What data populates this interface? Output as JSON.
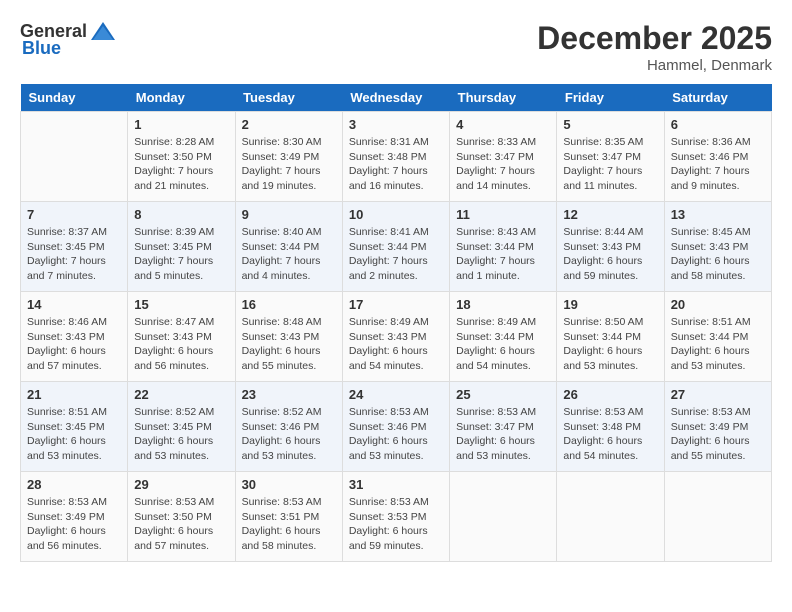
{
  "header": {
    "logo_general": "General",
    "logo_blue": "Blue",
    "month_title": "December 2025",
    "location": "Hammel, Denmark"
  },
  "calendar": {
    "days_of_week": [
      "Sunday",
      "Monday",
      "Tuesday",
      "Wednesday",
      "Thursday",
      "Friday",
      "Saturday"
    ],
    "weeks": [
      [
        {
          "day": "",
          "sunrise": "",
          "sunset": "",
          "daylight": ""
        },
        {
          "day": "1",
          "sunrise": "Sunrise: 8:28 AM",
          "sunset": "Sunset: 3:50 PM",
          "daylight": "Daylight: 7 hours and 21 minutes."
        },
        {
          "day": "2",
          "sunrise": "Sunrise: 8:30 AM",
          "sunset": "Sunset: 3:49 PM",
          "daylight": "Daylight: 7 hours and 19 minutes."
        },
        {
          "day": "3",
          "sunrise": "Sunrise: 8:31 AM",
          "sunset": "Sunset: 3:48 PM",
          "daylight": "Daylight: 7 hours and 16 minutes."
        },
        {
          "day": "4",
          "sunrise": "Sunrise: 8:33 AM",
          "sunset": "Sunset: 3:47 PM",
          "daylight": "Daylight: 7 hours and 14 minutes."
        },
        {
          "day": "5",
          "sunrise": "Sunrise: 8:35 AM",
          "sunset": "Sunset: 3:47 PM",
          "daylight": "Daylight: 7 hours and 11 minutes."
        },
        {
          "day": "6",
          "sunrise": "Sunrise: 8:36 AM",
          "sunset": "Sunset: 3:46 PM",
          "daylight": "Daylight: 7 hours and 9 minutes."
        }
      ],
      [
        {
          "day": "7",
          "sunrise": "Sunrise: 8:37 AM",
          "sunset": "Sunset: 3:45 PM",
          "daylight": "Daylight: 7 hours and 7 minutes."
        },
        {
          "day": "8",
          "sunrise": "Sunrise: 8:39 AM",
          "sunset": "Sunset: 3:45 PM",
          "daylight": "Daylight: 7 hours and 5 minutes."
        },
        {
          "day": "9",
          "sunrise": "Sunrise: 8:40 AM",
          "sunset": "Sunset: 3:44 PM",
          "daylight": "Daylight: 7 hours and 4 minutes."
        },
        {
          "day": "10",
          "sunrise": "Sunrise: 8:41 AM",
          "sunset": "Sunset: 3:44 PM",
          "daylight": "Daylight: 7 hours and 2 minutes."
        },
        {
          "day": "11",
          "sunrise": "Sunrise: 8:43 AM",
          "sunset": "Sunset: 3:44 PM",
          "daylight": "Daylight: 7 hours and 1 minute."
        },
        {
          "day": "12",
          "sunrise": "Sunrise: 8:44 AM",
          "sunset": "Sunset: 3:43 PM",
          "daylight": "Daylight: 6 hours and 59 minutes."
        },
        {
          "day": "13",
          "sunrise": "Sunrise: 8:45 AM",
          "sunset": "Sunset: 3:43 PM",
          "daylight": "Daylight: 6 hours and 58 minutes."
        }
      ],
      [
        {
          "day": "14",
          "sunrise": "Sunrise: 8:46 AM",
          "sunset": "Sunset: 3:43 PM",
          "daylight": "Daylight: 6 hours and 57 minutes."
        },
        {
          "day": "15",
          "sunrise": "Sunrise: 8:47 AM",
          "sunset": "Sunset: 3:43 PM",
          "daylight": "Daylight: 6 hours and 56 minutes."
        },
        {
          "day": "16",
          "sunrise": "Sunrise: 8:48 AM",
          "sunset": "Sunset: 3:43 PM",
          "daylight": "Daylight: 6 hours and 55 minutes."
        },
        {
          "day": "17",
          "sunrise": "Sunrise: 8:49 AM",
          "sunset": "Sunset: 3:43 PM",
          "daylight": "Daylight: 6 hours and 54 minutes."
        },
        {
          "day": "18",
          "sunrise": "Sunrise: 8:49 AM",
          "sunset": "Sunset: 3:44 PM",
          "daylight": "Daylight: 6 hours and 54 minutes."
        },
        {
          "day": "19",
          "sunrise": "Sunrise: 8:50 AM",
          "sunset": "Sunset: 3:44 PM",
          "daylight": "Daylight: 6 hours and 53 minutes."
        },
        {
          "day": "20",
          "sunrise": "Sunrise: 8:51 AM",
          "sunset": "Sunset: 3:44 PM",
          "daylight": "Daylight: 6 hours and 53 minutes."
        }
      ],
      [
        {
          "day": "21",
          "sunrise": "Sunrise: 8:51 AM",
          "sunset": "Sunset: 3:45 PM",
          "daylight": "Daylight: 6 hours and 53 minutes."
        },
        {
          "day": "22",
          "sunrise": "Sunrise: 8:52 AM",
          "sunset": "Sunset: 3:45 PM",
          "daylight": "Daylight: 6 hours and 53 minutes."
        },
        {
          "day": "23",
          "sunrise": "Sunrise: 8:52 AM",
          "sunset": "Sunset: 3:46 PM",
          "daylight": "Daylight: 6 hours and 53 minutes."
        },
        {
          "day": "24",
          "sunrise": "Sunrise: 8:53 AM",
          "sunset": "Sunset: 3:46 PM",
          "daylight": "Daylight: 6 hours and 53 minutes."
        },
        {
          "day": "25",
          "sunrise": "Sunrise: 8:53 AM",
          "sunset": "Sunset: 3:47 PM",
          "daylight": "Daylight: 6 hours and 53 minutes."
        },
        {
          "day": "26",
          "sunrise": "Sunrise: 8:53 AM",
          "sunset": "Sunset: 3:48 PM",
          "daylight": "Daylight: 6 hours and 54 minutes."
        },
        {
          "day": "27",
          "sunrise": "Sunrise: 8:53 AM",
          "sunset": "Sunset: 3:49 PM",
          "daylight": "Daylight: 6 hours and 55 minutes."
        }
      ],
      [
        {
          "day": "28",
          "sunrise": "Sunrise: 8:53 AM",
          "sunset": "Sunset: 3:49 PM",
          "daylight": "Daylight: 6 hours and 56 minutes."
        },
        {
          "day": "29",
          "sunrise": "Sunrise: 8:53 AM",
          "sunset": "Sunset: 3:50 PM",
          "daylight": "Daylight: 6 hours and 57 minutes."
        },
        {
          "day": "30",
          "sunrise": "Sunrise: 8:53 AM",
          "sunset": "Sunset: 3:51 PM",
          "daylight": "Daylight: 6 hours and 58 minutes."
        },
        {
          "day": "31",
          "sunrise": "Sunrise: 8:53 AM",
          "sunset": "Sunset: 3:53 PM",
          "daylight": "Daylight: 6 hours and 59 minutes."
        },
        {
          "day": "",
          "sunrise": "",
          "sunset": "",
          "daylight": ""
        },
        {
          "day": "",
          "sunrise": "",
          "sunset": "",
          "daylight": ""
        },
        {
          "day": "",
          "sunrise": "",
          "sunset": "",
          "daylight": ""
        }
      ]
    ]
  }
}
